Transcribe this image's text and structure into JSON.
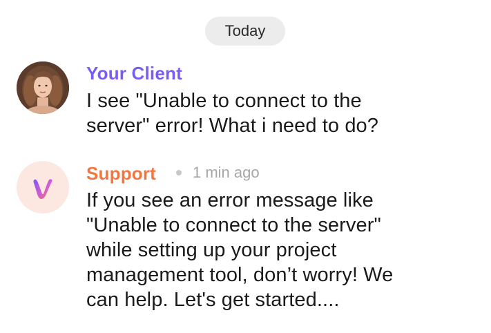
{
  "date_separator": "Today",
  "messages": [
    {
      "sender": "Your Client",
      "sender_color": "#7b5cf2",
      "avatar_icon": "woman-portrait-avatar",
      "text_lines": [
        "I see \"Unable to connect to the",
        "server\" error! What i need to do?"
      ]
    },
    {
      "sender": "Support",
      "sender_color": "#f2763f",
      "avatar_icon": "brand-logo-avatar",
      "timestamp": "1 min ago",
      "text_lines": [
        "If you see an error message like",
        "\"Unable to connect to the server\"",
        "while setting up your project",
        "management tool, don’t worry! We",
        "can help. Let's get started...."
      ]
    }
  ]
}
